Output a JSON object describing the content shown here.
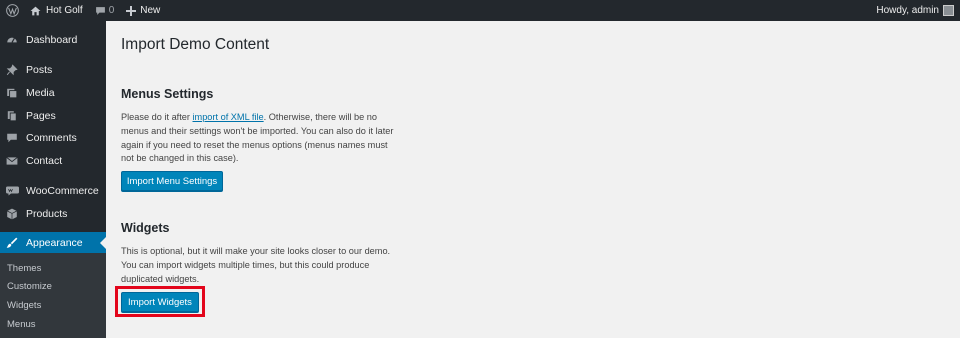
{
  "adminbar": {
    "site_name": "Hot Golf",
    "comments_count": "0",
    "new_label": "New",
    "howdy": "Howdy, admin"
  },
  "sidebar": {
    "items": [
      {
        "label": "Dashboard",
        "icon": "dashboard-icon"
      },
      {
        "label": "Posts",
        "icon": "pin-icon"
      },
      {
        "label": "Media",
        "icon": "media-icon"
      },
      {
        "label": "Pages",
        "icon": "pages-icon"
      },
      {
        "label": "Comments",
        "icon": "comment-icon"
      },
      {
        "label": "Contact",
        "icon": "mail-icon"
      },
      {
        "label": "WooCommerce",
        "icon": "woo-icon"
      },
      {
        "label": "Products",
        "icon": "box-icon"
      },
      {
        "label": "Appearance",
        "icon": "brush-icon"
      }
    ],
    "submenu": [
      "Themes",
      "Customize",
      "Widgets",
      "Menus"
    ]
  },
  "main": {
    "title": "Import Demo Content",
    "menus": {
      "heading": "Menus Settings",
      "desc_before": "Please do it after ",
      "desc_link": "import of XML file",
      "desc_after": ". Otherwise, there will be no menus and their settings won't be imported. You can also do it later again if you need to reset the menus options (menus names must not be changed in this case).",
      "button": "Import Menu Settings"
    },
    "widgets": {
      "heading": "Widgets",
      "desc": "This is optional, but it will make your site looks closer to our demo. You can import widgets multiple times, but this could produce duplicated widgets.",
      "button": "Import Widgets"
    }
  },
  "colors": {
    "admin_bg": "#23282d",
    "accent": "#0073aa",
    "button": "#0085ba",
    "highlight": "#e3051b"
  }
}
